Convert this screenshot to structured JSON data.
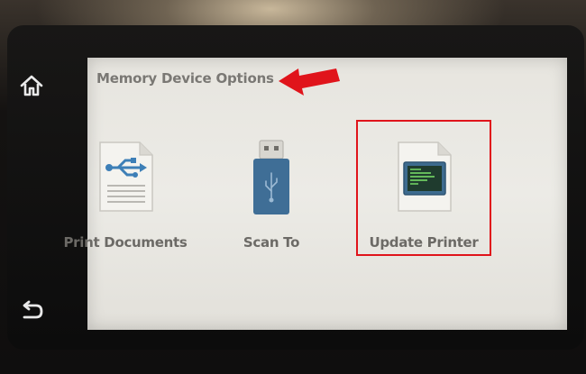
{
  "screen": {
    "title": "Memory Device Options",
    "options": [
      {
        "label": "Print Documents",
        "icon": "usb-document-icon"
      },
      {
        "label": "Scan To",
        "icon": "usb-drive-icon"
      },
      {
        "label": "Update Printer",
        "icon": "firmware-update-icon"
      }
    ]
  },
  "sidebar": {
    "home_icon": "home-icon",
    "back_icon": "back-icon"
  },
  "annotations": {
    "arrow_color": "#e0141b",
    "highlight_color": "#e0141b",
    "highlighted_option": "Update Printer"
  },
  "colors": {
    "icon_blue": "#3d7fb7",
    "screen_bg": "#e7e5df",
    "text": "#6c6a66"
  }
}
